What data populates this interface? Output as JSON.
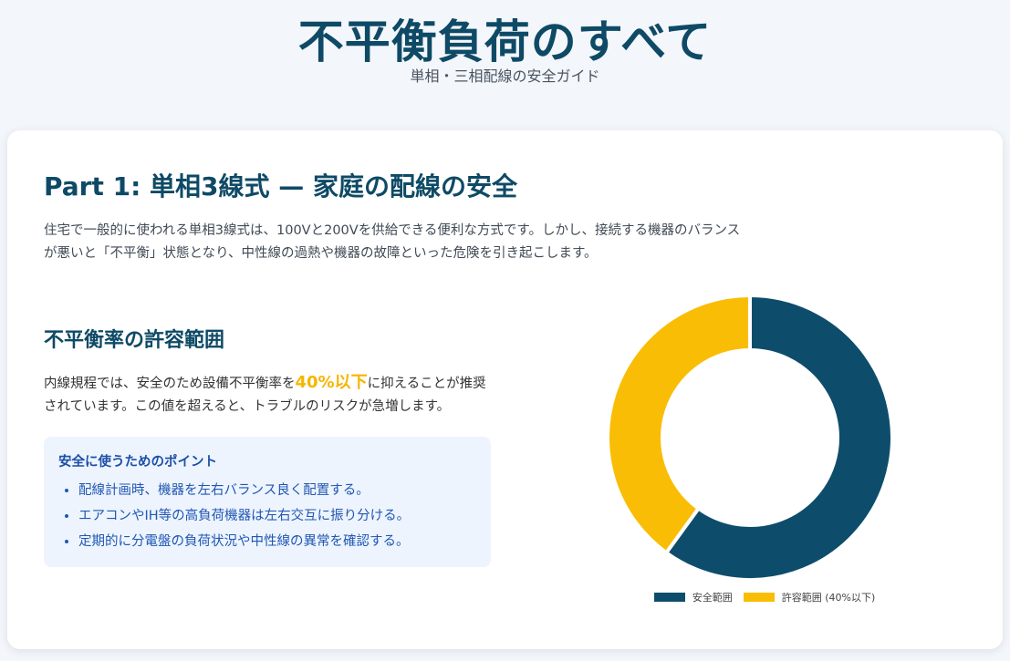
{
  "header": {
    "title": "不平衡負荷のすべて",
    "subtitle": "単相・三相配線の安全ガイド"
  },
  "part1": {
    "title": "Part 1: 単相3線式 — 家庭の配線の安全",
    "intro": "住宅で一般的に使われる単相3線式は、100Vと200Vを供給できる便利な方式です。しかし、接続する機器のバランスが悪いと「不平衡」状態となり、中性線の過熱や機器の故障といった危険を引き起こします。"
  },
  "section": {
    "title": "不平衡率の許容範囲",
    "text_before": "内線規程では、安全のため設備不平衡率を",
    "highlight": "40%以下",
    "text_after": "に抑えることが推奨されています。この値を超えると、トラブルのリスクが急増します。"
  },
  "tips": {
    "title": "安全に使うためのポイント",
    "items": [
      "配線計画時、機器を左右バランス良く配置する。",
      "エアコンやIH等の高負荷機器は左右交互に振り分ける。",
      "定期的に分電盤の負荷状況や中性線の異常を確認する。"
    ]
  },
  "chart_data": {
    "type": "pie",
    "variant": "doughnut",
    "categories": [
      "安全範囲",
      "許容範囲 (40%以下)"
    ],
    "values": [
      60,
      40
    ],
    "colors": [
      "#0d4d6b",
      "#f9bd05"
    ],
    "legend_position": "bottom"
  }
}
